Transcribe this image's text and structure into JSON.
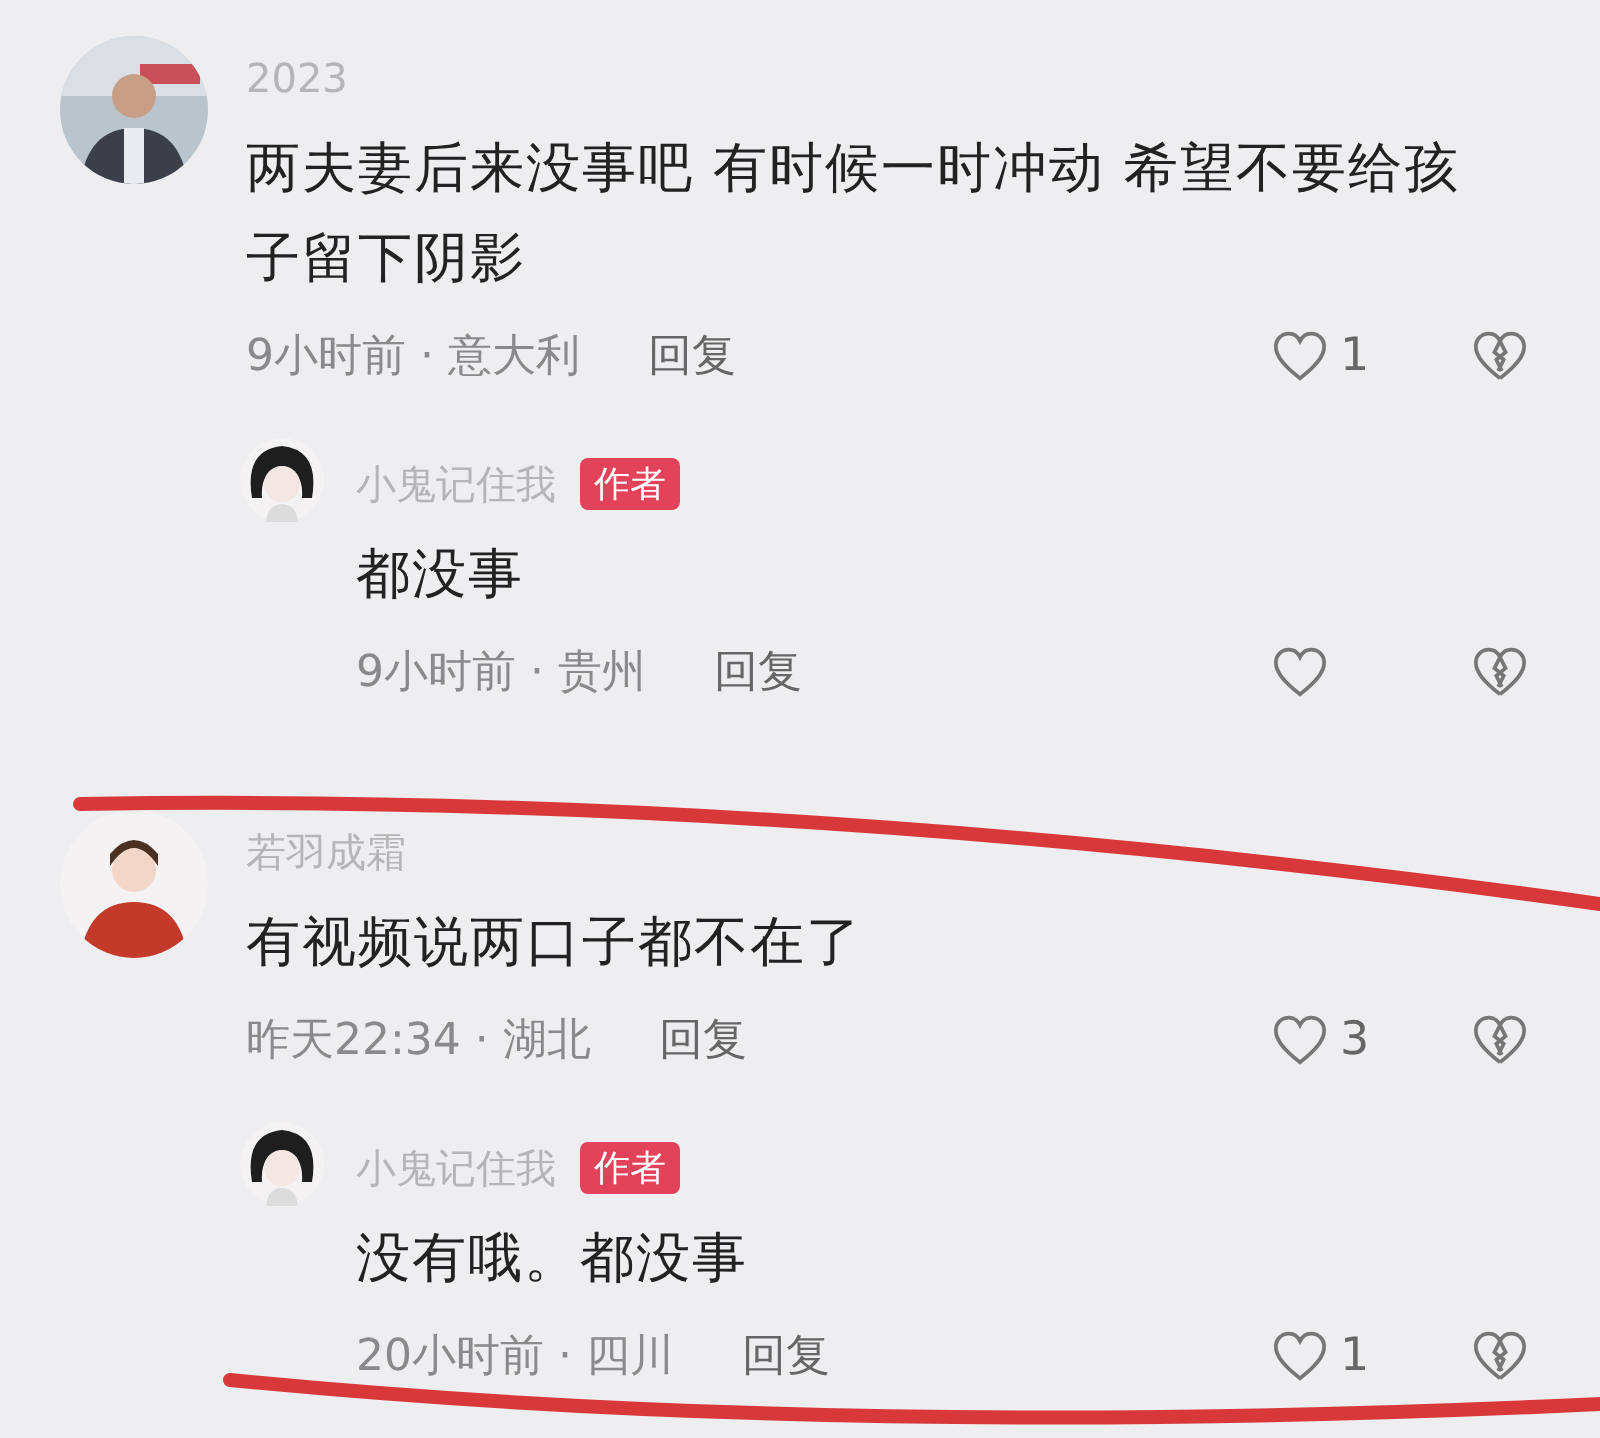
{
  "comments": [
    {
      "username": "2023",
      "text": "两夫妻后来没事吧 有时候一时冲动 希望不要给孩子留下阴影",
      "meta": "9小时前 · 意大利",
      "reply_label": "回复",
      "likes": "1",
      "replies": [
        {
          "username": "小鬼记住我",
          "author": true,
          "author_label": "作者",
          "text": "都没事",
          "meta": "9小时前 · 贵州",
          "reply_label": "回复"
        }
      ]
    },
    {
      "username": "若羽成霜",
      "text": "有视频说两口子都不在了",
      "meta": "昨天22:34 · 湖北",
      "reply_label": "回复",
      "likes": "3",
      "replies": [
        {
          "username": "小鬼记住我",
          "author": true,
          "author_label": "作者",
          "text": "没有哦。都没事",
          "meta": "20小时前 · 四川",
          "reply_label": "回复",
          "likes": "1"
        }
      ]
    }
  ]
}
